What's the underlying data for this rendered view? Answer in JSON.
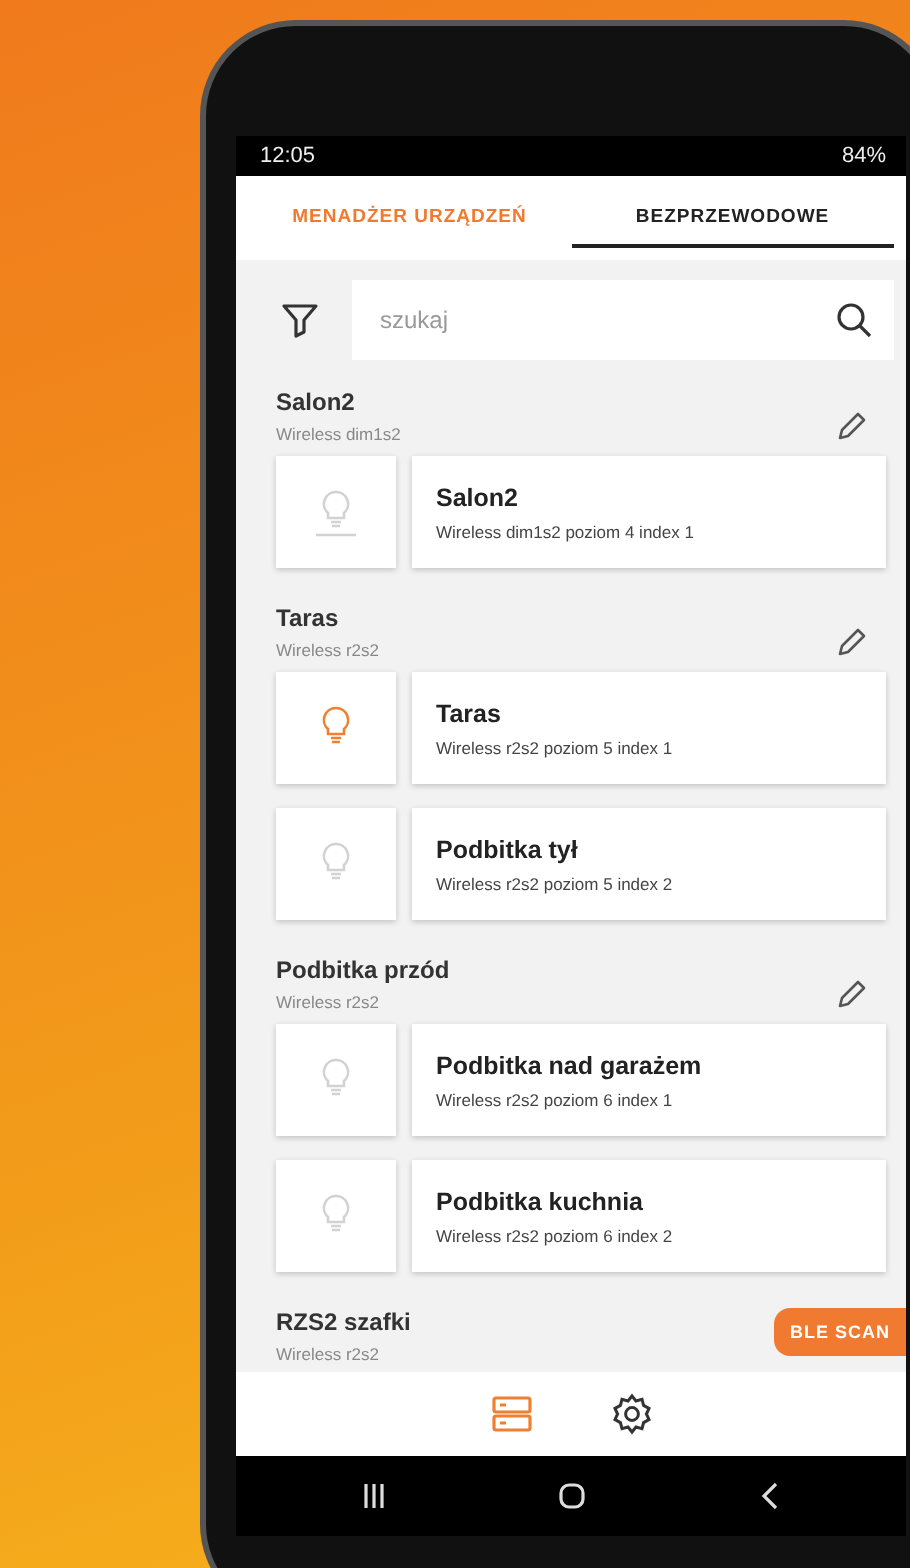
{
  "status_bar": {
    "time": "12:05",
    "battery": "84%"
  },
  "tabs": [
    {
      "label": "MENADŻER URZĄDZEŃ",
      "selected": false
    },
    {
      "label": "BEZPRZEWODOWE",
      "selected": true
    }
  ],
  "search": {
    "placeholder": "szukaj"
  },
  "groups": [
    {
      "name": "Salon2",
      "type": "Wireless dim1s2",
      "devices": [
        {
          "kind": "dimmer",
          "on": false,
          "name": "Salon2",
          "detail": "Wireless dim1s2 poziom 4 index 1"
        }
      ]
    },
    {
      "name": "Taras",
      "type": "Wireless r2s2",
      "devices": [
        {
          "kind": "relay",
          "on": true,
          "name": "Taras",
          "detail": "Wireless r2s2 poziom 5 index 1"
        },
        {
          "kind": "relay",
          "on": false,
          "name": "Podbitka tył",
          "detail": "Wireless r2s2 poziom 5 index 2"
        }
      ]
    },
    {
      "name": "Podbitka przód",
      "type": "Wireless r2s2",
      "devices": [
        {
          "kind": "relay",
          "on": false,
          "name": "Podbitka nad garażem",
          "detail": "Wireless r2s2 poziom 6 index 1"
        },
        {
          "kind": "relay",
          "on": false,
          "name": "Podbitka kuchnia",
          "detail": "Wireless r2s2 poziom 6 index 2"
        }
      ]
    },
    {
      "name": "RZS2 szafki",
      "type": "Wireless r2s2"
    }
  ],
  "scan_button": "BLE SCAN",
  "bottom_nav": [
    {
      "kind": "devices",
      "selected": true
    },
    {
      "kind": "settings",
      "selected": false
    }
  ]
}
